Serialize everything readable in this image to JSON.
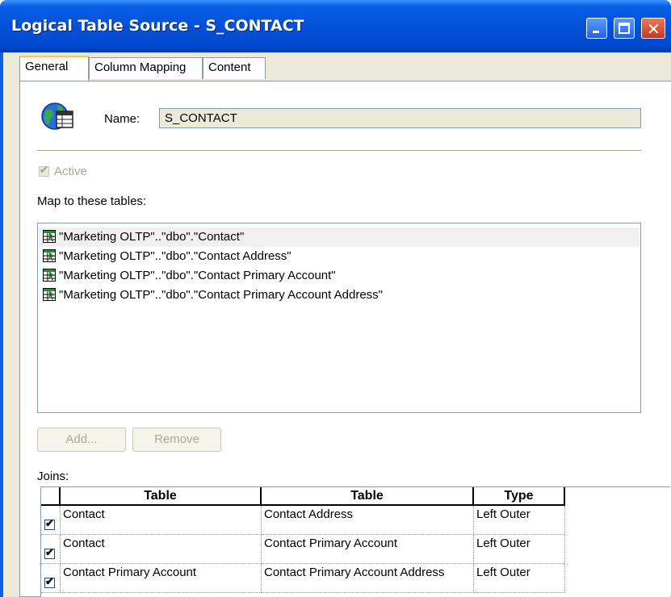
{
  "window": {
    "title": "Logical Table Source - S_CONTACT"
  },
  "tabs": [
    {
      "label": "General",
      "active": true
    },
    {
      "label": "Column Mapping",
      "active": false
    },
    {
      "label": "Content",
      "active": false
    }
  ],
  "name": {
    "label": "Name:",
    "value": "S_CONTACT"
  },
  "active": {
    "label": "Active",
    "checked": true,
    "enabled": false
  },
  "map": {
    "label": "Map to these tables:",
    "items": [
      "\"Marketing OLTP\"..\"dbo\".\"Contact\"",
      "\"Marketing OLTP\"..\"dbo\".\"Contact Address\"",
      "\"Marketing OLTP\"..\"dbo\".\"Contact Primary Account\"",
      "\"Marketing OLTP\"..\"dbo\".\"Contact Primary Account Address\""
    ]
  },
  "buttons": {
    "add": "Add...",
    "remove": "Remove"
  },
  "joins": {
    "label": "Joins:",
    "columns": [
      "Table",
      "Table",
      "Type"
    ],
    "rows": [
      {
        "checked": true,
        "left": "Contact",
        "right": "Contact Address",
        "type": "Left Outer"
      },
      {
        "checked": true,
        "left": "Contact",
        "right": "Contact Primary Account",
        "type": "Left Outer"
      },
      {
        "checked": true,
        "left": "Contact Primary Account",
        "right": "Contact Primary Account Address",
        "type": "Left Outer"
      }
    ]
  },
  "icons": {
    "logical-source": "globe-table-icon",
    "physical-table": "table-icon"
  },
  "colors": {
    "titlebar": "#0351d8",
    "frame": "#ece9d8",
    "selection": "#f0f0f0"
  }
}
